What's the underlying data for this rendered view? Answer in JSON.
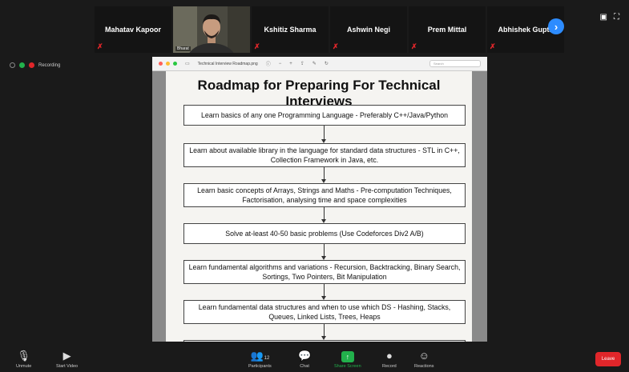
{
  "participants": [
    {
      "name": "Mahatav Kapoor",
      "muted": true
    },
    {
      "name": "Bharat",
      "muted": false,
      "video": true
    },
    {
      "name": "Kshitiz Sharma",
      "muted": true
    },
    {
      "name": "Ashwin Negi",
      "muted": true
    },
    {
      "name": "Prem Mittal",
      "muted": true
    },
    {
      "name": "Abhishek Gupta",
      "muted": true
    }
  ],
  "recording": {
    "label": "Recording"
  },
  "viewer": {
    "title": "Technical Interview Roadmap.png",
    "search_placeholder": "Search"
  },
  "document": {
    "title": "Roadmap for Preparing For Technical Interviews",
    "steps": [
      "Learn basics of any one Programming Language - Preferably C++/Java/Python",
      "Learn about available library in the language for standard data structures - STL in C++, Collection Framework in Java, etc.",
      "Learn basic concepts of Arrays, Strings and Maths - Pre-computation Techniques, Factorisation, analysing time and space complexities",
      "Solve at-least 40-50 basic problems  (Use Codeforces Div2 A/B)",
      "Learn fundamental algorithms and variations - Recursion, Backtracking, Binary Search, Sortings, Two Pointers, Bit Manipulation",
      "Learn fundamental data structures and when to use which DS - Hashing, Stacks, Queues, Linked Lists, Trees, Heaps"
    ]
  },
  "toolbar": {
    "unmute": "Unmute",
    "start_video": "Start Video",
    "participants": "Participants",
    "participant_count": "12",
    "chat": "Chat",
    "share_screen": "Share Screen",
    "record": "Record",
    "reactions": "Reactions",
    "leave": "Leave"
  },
  "colors": {
    "accent": "#2d8cff",
    "share": "#22b14c",
    "leave": "#e0262a",
    "muted": "#e0262a"
  }
}
